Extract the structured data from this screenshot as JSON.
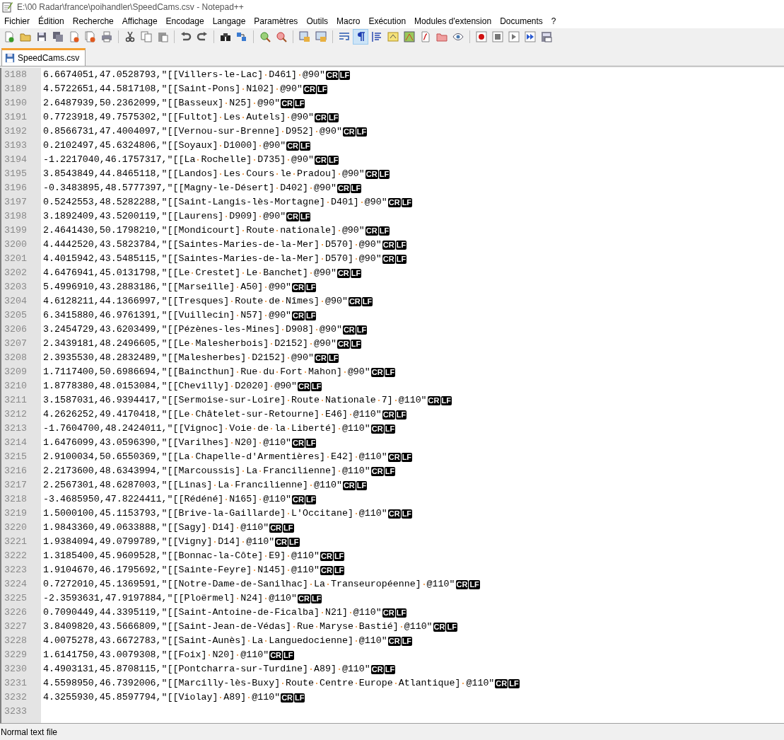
{
  "window": {
    "title": "E:\\00 Radar\\france\\poihandler\\SpeedCams.csv - Notepad++"
  },
  "menu": [
    "Fichier",
    "Édition",
    "Recherche",
    "Affichage",
    "Encodage",
    "Langage",
    "Paramètres",
    "Outils",
    "Macro",
    "Exécution",
    "Modules d'extension",
    "Documents",
    "?"
  ],
  "toolbar": {
    "show_all_characters_on": true
  },
  "tabs": [
    {
      "label": "SpeedCams.csv",
      "selected": true
    }
  ],
  "lines": [
    {
      "number": "3188",
      "text": "6.6674051,47.0528793,\"[[Villers-le-Lac] D461] @90\"",
      "eol": [
        "CR",
        "LF"
      ]
    },
    {
      "number": "3189",
      "text": "4.5722651,44.5817108,\"[[Saint-Pons] N102] @90\"",
      "eol": [
        "CR",
        "LF"
      ]
    },
    {
      "number": "3190",
      "text": "2.6487939,50.2362099,\"[[Basseux] N25] @90\"",
      "eol": [
        "CR",
        "LF"
      ]
    },
    {
      "number": "3191",
      "text": "0.7723918,49.7575302,\"[[Fultot] Les Autels] @90\"",
      "eol": [
        "CR",
        "LF"
      ]
    },
    {
      "number": "3192",
      "text": "0.8566731,47.4004097,\"[[Vernou-sur-Brenne] D952] @90\"",
      "eol": [
        "CR",
        "LF"
      ]
    },
    {
      "number": "3193",
      "text": "0.2102497,45.6324806,\"[[Soyaux] D1000] @90\"",
      "eol": [
        "CR",
        "LF"
      ]
    },
    {
      "number": "3194",
      "text": "-1.2217040,46.1757317,\"[[La Rochelle] D735] @90\"",
      "eol": [
        "CR",
        "LF"
      ]
    },
    {
      "number": "3195",
      "text": "3.8543849,44.8465118,\"[[Landos] Les Cours le Pradou] @90\"",
      "eol": [
        "CR",
        "LF"
      ]
    },
    {
      "number": "3196",
      "text": "-0.3483895,48.5777397,\"[[Magny-le-Désert] D402] @90\"",
      "eol": [
        "CR",
        "LF"
      ]
    },
    {
      "number": "3197",
      "text": "0.5242553,48.5282288,\"[[Saint-Langis-lès-Mortagne] D401] @90\"",
      "eol": [
        "CR",
        "LF"
      ]
    },
    {
      "number": "3198",
      "text": "3.1892409,43.5200119,\"[[Laurens] D909] @90\"",
      "eol": [
        "CR",
        "LF"
      ]
    },
    {
      "number": "3199",
      "text": "2.4641430,50.1798210,\"[[Mondicourt] Route nationale] @90\"",
      "eol": [
        "CR",
        "LF"
      ]
    },
    {
      "number": "3200",
      "text": "4.4442520,43.5823784,\"[[Saintes-Maries-de-la-Mer] D570] @90\"",
      "eol": [
        "CR",
        "LF"
      ]
    },
    {
      "number": "3201",
      "text": "4.4015942,43.5485115,\"[[Saintes-Maries-de-la-Mer] D570] @90\"",
      "eol": [
        "CR",
        "LF"
      ]
    },
    {
      "number": "3202",
      "text": "4.6476941,45.0131798,\"[[Le Crestet] Le Banchet] @90\"",
      "eol": [
        "CR",
        "LF"
      ]
    },
    {
      "number": "3203",
      "text": "5.4996910,43.2883186,\"[[Marseille] A50] @90\"",
      "eol": [
        "CR",
        "LF"
      ]
    },
    {
      "number": "3204",
      "text": "4.6128211,44.1366997,\"[[Tresques] Route de Nîmes] @90\"",
      "eol": [
        "CR",
        "LF"
      ]
    },
    {
      "number": "3205",
      "text": "6.3415880,46.9761391,\"[[Vuillecin] N57] @90\"",
      "eol": [
        "CR",
        "LF"
      ]
    },
    {
      "number": "3206",
      "text": "3.2454729,43.6203499,\"[[Pézènes-les-Mines] D908] @90\"",
      "eol": [
        "CR",
        "LF"
      ]
    },
    {
      "number": "3207",
      "text": "2.3439181,48.2496605,\"[[Le Malesherbois] D2152] @90\"",
      "eol": [
        "CR",
        "LF"
      ]
    },
    {
      "number": "3208",
      "text": "2.3935530,48.2832489,\"[[Malesherbes] D2152] @90\"",
      "eol": [
        "CR",
        "LF"
      ]
    },
    {
      "number": "3209",
      "text": "1.7117400,50.6986694,\"[[Baincthun] Rue du Fort Mahon] @90\"",
      "eol": [
        "CR",
        "LF"
      ]
    },
    {
      "number": "3210",
      "text": "1.8778380,48.0153084,\"[[Chevilly] D2020] @90\"",
      "eol": [
        "CR",
        "LF"
      ]
    },
    {
      "number": "3211",
      "text": "3.1587031,46.9394417,\"[[Sermoise-sur-Loire] Route Nationale 7] @110\"",
      "eol": [
        "CR",
        "LF"
      ]
    },
    {
      "number": "3212",
      "text": "4.2626252,49.4170418,\"[[Le Châtelet-sur-Retourne] E46] @110\"",
      "eol": [
        "CR",
        "LF"
      ]
    },
    {
      "number": "3213",
      "text": "-1.7604700,48.2424011,\"[[Vignoc] Voie de la Liberté] @110\"",
      "eol": [
        "CR",
        "LF"
      ]
    },
    {
      "number": "3214",
      "text": "1.6476099,43.0596390,\"[[Varilhes] N20] @110\"",
      "eol": [
        "CR",
        "LF"
      ]
    },
    {
      "number": "3215",
      "text": "2.9100034,50.6550369,\"[[La Chapelle-d'Armentières] E42] @110\"",
      "eol": [
        "CR",
        "LF"
      ]
    },
    {
      "number": "3216",
      "text": "2.2173600,48.6343994,\"[[Marcoussis] La Francilienne] @110\"",
      "eol": [
        "CR",
        "LF"
      ]
    },
    {
      "number": "3217",
      "text": "2.2567301,48.6287003,\"[[Linas] La Francilienne] @110\"",
      "eol": [
        "CR",
        "LF"
      ]
    },
    {
      "number": "3218",
      "text": "-3.4685950,47.8224411,\"[[Rédéné] N165] @110\"",
      "eol": [
        "CR",
        "LF"
      ]
    },
    {
      "number": "3219",
      "text": "1.5000100,45.1153793,\"[[Brive-la-Gaillarde] L'Occitane] @110\"",
      "eol": [
        "CR",
        "LF"
      ]
    },
    {
      "number": "3220",
      "text": "1.9843360,49.0633888,\"[[Sagy] D14] @110\"",
      "eol": [
        "CR",
        "LF"
      ]
    },
    {
      "number": "3221",
      "text": "1.9384094,49.0799789,\"[[Vigny] D14] @110\"",
      "eol": [
        "CR",
        "LF"
      ]
    },
    {
      "number": "3222",
      "text": "1.3185400,45.9609528,\"[[Bonnac-la-Côte] E9] @110\"",
      "eol": [
        "CR",
        "LF"
      ]
    },
    {
      "number": "3223",
      "text": "1.9104670,46.1795692,\"[[Sainte-Feyre] N145] @110\"",
      "eol": [
        "CR",
        "LF"
      ]
    },
    {
      "number": "3224",
      "text": "0.7272010,45.1369591,\"[[Notre-Dame-de-Sanilhac] La Transeuropéenne] @110\"",
      "eol": [
        "CR",
        "LF"
      ]
    },
    {
      "number": "3225",
      "text": "-2.3593631,47.9197884,\"[[Ploërmel] N24] @110\"",
      "eol": [
        "CR",
        "LF"
      ]
    },
    {
      "number": "3226",
      "text": "0.7090449,44.3395119,\"[[Saint-Antoine-de-Ficalba] N21] @110\"",
      "eol": [
        "CR",
        "LF"
      ]
    },
    {
      "number": "3227",
      "text": "3.8409820,43.5666809,\"[[Saint-Jean-de-Védas] Rue Maryse Bastié] @110\"",
      "eol": [
        "CR",
        "LF"
      ]
    },
    {
      "number": "3228",
      "text": "4.0075278,43.6672783,\"[[Saint-Aunès] La Languedocienne] @110\"",
      "eol": [
        "CR",
        "LF"
      ]
    },
    {
      "number": "3229",
      "text": "1.6141750,43.0079308,\"[[Foix] N20] @110\"",
      "eol": [
        "CR",
        "LF"
      ]
    },
    {
      "number": "3230",
      "text": "4.4903131,45.8708115,\"[[Pontcharra-sur-Turdine] A89] @110\"",
      "eol": [
        "CR",
        "LF"
      ]
    },
    {
      "number": "3231",
      "text": "4.5598950,46.7392006,\"[[Marcilly-lès-Buxy] Route Centre Europe Atlantique] @110\"",
      "eol": [
        "CR",
        "LF"
      ]
    },
    {
      "number": "3232",
      "text": "4.3255930,45.8597794,\"[[Violay] A89] @110\"",
      "eol": [
        "CR",
        "LF"
      ]
    },
    {
      "number": "3233"
    }
  ],
  "status_bar": {
    "file_type": "Normal text file"
  }
}
